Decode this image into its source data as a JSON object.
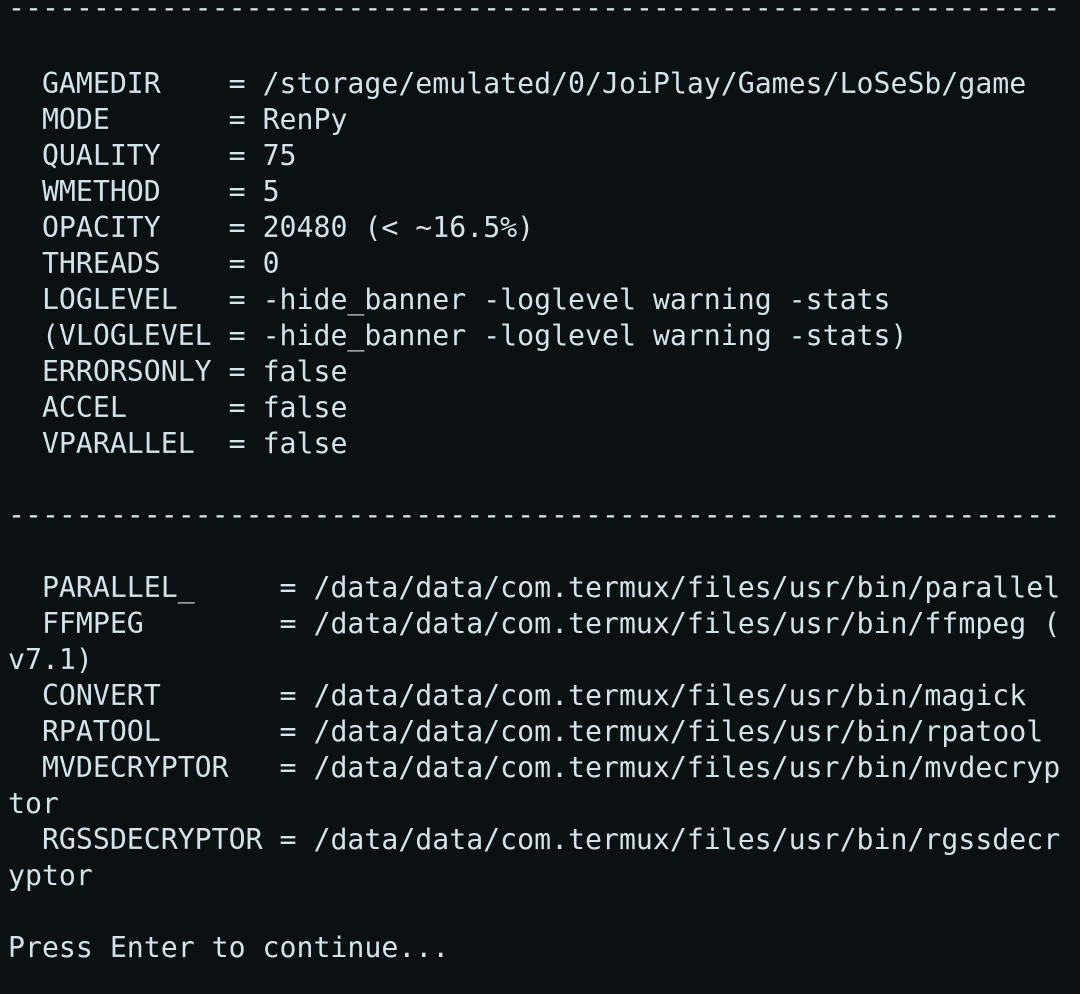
{
  "terminal": {
    "separator": "--------------------------------------------------------------",
    "config": [
      {
        "key": "  GAMEDIR    ",
        "eq": "= ",
        "value": "/storage/emulated/0/JoiPlay/Games/LoSeSb/game"
      },
      {
        "key": "  MODE       ",
        "eq": "= ",
        "value": "RenPy"
      },
      {
        "key": "  QUALITY    ",
        "eq": "= ",
        "value": "75"
      },
      {
        "key": "  WMETHOD    ",
        "eq": "= ",
        "value": "5"
      },
      {
        "key": "  OPACITY    ",
        "eq": "= ",
        "value": "20480 (< ~16.5%)"
      },
      {
        "key": "  THREADS    ",
        "eq": "= ",
        "value": "0"
      },
      {
        "key": "  LOGLEVEL   ",
        "eq": "= ",
        "value": "-hide_banner -loglevel warning -stats"
      },
      {
        "key": "  (VLOGLEVEL ",
        "eq": "= ",
        "value": "-hide_banner -loglevel warning -stats)"
      },
      {
        "key": "  ERRORSONLY ",
        "eq": "= ",
        "value": "false"
      },
      {
        "key": "  ACCEL      ",
        "eq": "= ",
        "value": "false"
      },
      {
        "key": "  VPARALLEL  ",
        "eq": "= ",
        "value": "false"
      }
    ],
    "tools": [
      {
        "key": "  PARALLEL_     ",
        "eq": "= ",
        "value": "/data/data/com.termux/files/usr/bin/parallel",
        "wrap": ""
      },
      {
        "key": "  FFMPEG        ",
        "eq": "= ",
        "value": "/data/data/com.termux/files/usr/bin/ffmpeg (",
        "wrap": "v7.1)"
      },
      {
        "key": "  CONVERT       ",
        "eq": "= ",
        "value": "/data/data/com.termux/files/usr/bin/magick",
        "wrap": ""
      },
      {
        "key": "  RPATOOL       ",
        "eq": "= ",
        "value": "/data/data/com.termux/files/usr/bin/rpatool",
        "wrap": ""
      },
      {
        "key": "  MVDECRYPTOR   ",
        "eq": "= ",
        "value": "/data/data/com.termux/files/usr/bin/mvdecryp",
        "wrap": "tor"
      },
      {
        "key": "  RGSSDECRYPTOR ",
        "eq": "= ",
        "value": "/data/data/com.termux/files/usr/bin/rgssdecr",
        "wrap": "yptor"
      }
    ],
    "prompt": "Press Enter to continue..."
  }
}
